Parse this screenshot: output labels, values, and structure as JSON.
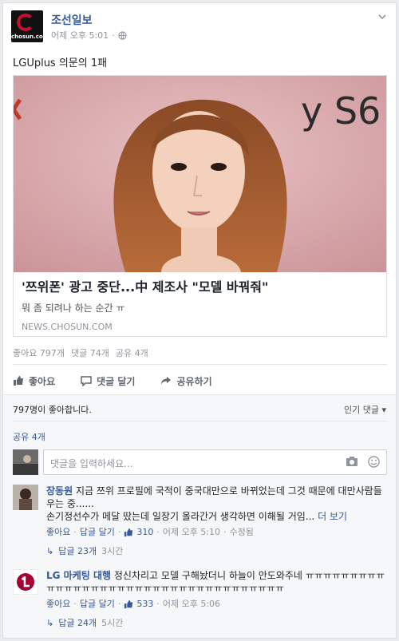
{
  "post": {
    "page_name": "조선일보",
    "logo_text": "chosun.com",
    "time": "어제 오후 5:01",
    "separator": "·",
    "status": "LGUplus 의문의 1패",
    "link": {
      "title": "'쯔위폰' 광고 중단...中 제조사 \"모델 바꿔줘\"",
      "description": "뭐 좀 되려나 하는 순간 ㅠ",
      "domain": "NEWS.CHOSUN.COM",
      "image_text": "y S6"
    },
    "counts": {
      "likes": "좋아요 797개",
      "comments": "댓글 74개",
      "shares": "공유 4개"
    },
    "actions": {
      "like": "좋아요",
      "comment": "댓글 달기",
      "share": "공유하기"
    }
  },
  "comments_section": {
    "like_summary": "797명이 좋아합니다.",
    "sort_label": "인기 댓글",
    "share_count": "공유 4개",
    "input_placeholder": "댓글을 입력하세요...",
    "comments": [
      {
        "author": "장동원",
        "text": "지금 쯔위 프로필에 국적이 중국대만으로 바뀌었는데 그것 때문에 대만사람들 우는 중......",
        "text2": "손기정선수가 메달 땄는데 일장기 올라간거 생각하면 이해될 거임...",
        "more": "더 보기",
        "like": "좋아요",
        "reply": "답글 달기",
        "like_count": "310",
        "time": "어제 오후 5:10",
        "edited": "수정됨",
        "replies": "답글 23개",
        "reply_time": "3시간"
      },
      {
        "author": "LG 마케팅 대행",
        "text": "정신차리고 모델 구해놨더니 하늘이 안도와주네 ㅠㅠㅠㅠㅠㅠㅠㅠㅠㅠㅠㅠㅠㅠㅠㅠㅠㅠㅠㅠㅠㅠㅠㅠㅠㅠㅠㅠㅠㅠㅠㅠㅠㅠㅠㅠ",
        "like": "좋아요",
        "reply": "답글 달기",
        "like_count": "533",
        "time": "어제 오후 5:06",
        "replies": "답글 24개",
        "reply_time": "5시간"
      }
    ]
  },
  "colors": {
    "link_blue": "#365899",
    "gray": "#90949c",
    "logo_red": "#c8102e"
  }
}
